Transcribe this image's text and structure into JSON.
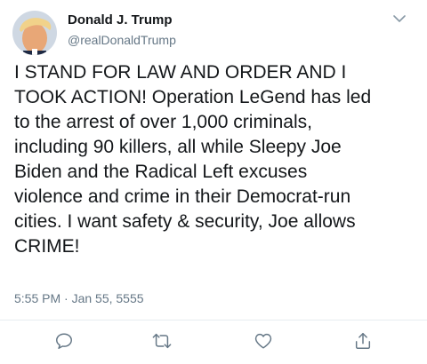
{
  "author": {
    "display_name": "Donald J. Trump",
    "handle": "@realDonaldTrump"
  },
  "tweet": {
    "text": "I STAND FOR LAW AND ORDER AND I\nTOOK ACTION! Operation LeGend has led\nto the arrest of over 1,000 criminals,\nincluding 90 killers, all while Sleepy Joe\nBiden and the Radical Left excuses\nviolence and crime in their Democrat-run\ncities. I want safety & security, Joe allows\nCRIME!",
    "timestamp": "5:55 PM · Jan 55, 5555"
  },
  "icons": {
    "menu": "chevron-down-icon",
    "reply": "reply-icon",
    "retweet": "retweet-icon",
    "like": "heart-icon",
    "share": "share-icon"
  },
  "colors": {
    "text": "#14171a",
    "secondary": "#657786",
    "icon": "#657786",
    "divider": "#e6ecf0"
  }
}
